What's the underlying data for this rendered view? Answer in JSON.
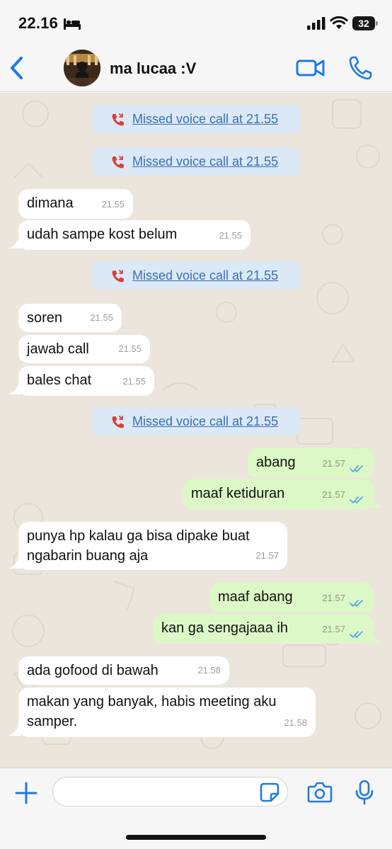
{
  "status_bar": {
    "time": "22.16",
    "battery": "32"
  },
  "header": {
    "contact_name": "ma lucaa :V"
  },
  "messages": [
    {
      "kind": "system",
      "text": "Missed voice call at 21.55"
    },
    {
      "kind": "system",
      "text": "Missed voice call at 21.55"
    },
    {
      "kind": "in",
      "text": "dimana",
      "time": "21.55"
    },
    {
      "kind": "in",
      "text": "udah sampe kost belum",
      "time": "21.55"
    },
    {
      "kind": "system",
      "text": "Missed voice call at 21.55"
    },
    {
      "kind": "in",
      "text": "soren",
      "time": "21.55"
    },
    {
      "kind": "in",
      "text": "jawab call",
      "time": "21.55"
    },
    {
      "kind": "in",
      "text": "bales chat",
      "time": "21.55"
    },
    {
      "kind": "system",
      "text": "Missed voice call at 21.55"
    },
    {
      "kind": "out",
      "text": "abang",
      "time": "21.57",
      "status": "read"
    },
    {
      "kind": "out",
      "text": "maaf ketiduran",
      "time": "21.57",
      "status": "read"
    },
    {
      "kind": "in",
      "text": "punya hp kalau ga bisa dipake buat ngabarin buang aja",
      "time": "21.57"
    },
    {
      "kind": "out",
      "text": "maaf abang",
      "time": "21.57",
      "status": "read"
    },
    {
      "kind": "out",
      "text": "kan ga sengajaaa ih",
      "time": "21.57",
      "status": "read"
    },
    {
      "kind": "in",
      "text": "ada gofood di bawah",
      "time": "21.58"
    },
    {
      "kind": "in",
      "text": "makan yang banyak, habis meeting aku samper.",
      "time": "21.58"
    }
  ],
  "input": {
    "value": "",
    "placeholder": ""
  },
  "icons": {
    "back": "chevron-left-icon",
    "video": "video-camera-icon",
    "call": "phone-icon",
    "plus": "plus-icon",
    "sticker": "sticker-icon",
    "camera": "camera-icon",
    "mic": "microphone-icon",
    "missed_call": "missed-call-icon",
    "read_ticks": "double-check-icon"
  },
  "colors": {
    "accent": "#1f7ae0",
    "incoming_bubble": "#ffffff",
    "outgoing_bubble": "#dcf8c6",
    "system_bubble": "#dbe9f6",
    "chat_background": "#ece5dc",
    "missed_call": "#d9403a",
    "read_ticks": "#4aa3e6"
  }
}
